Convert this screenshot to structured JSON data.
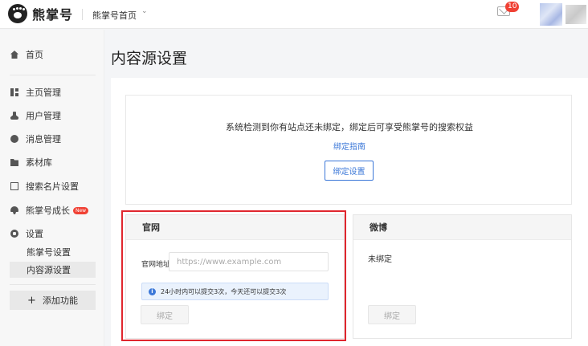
{
  "header": {
    "logo_text": "熊掌号",
    "nav_label": "熊掌号首页",
    "caret": "⌄",
    "notifications_count": "10"
  },
  "sidebar": {
    "items": [
      {
        "label": "首页",
        "icon": "home-icon"
      },
      {
        "label": "主页管理",
        "icon": "grid-icon"
      },
      {
        "label": "用户管理",
        "icon": "user-icon"
      },
      {
        "label": "消息管理",
        "icon": "message-icon"
      },
      {
        "label": "素材库",
        "icon": "folder-icon"
      },
      {
        "label": "搜索名片设置",
        "icon": "card-icon"
      },
      {
        "label": "熊掌号成长",
        "icon": "growth-icon",
        "tag": "New"
      },
      {
        "label": "设置",
        "icon": "gear-icon"
      }
    ],
    "sub_items": [
      {
        "label": "熊掌号设置"
      },
      {
        "label": "内容源设置",
        "active": true
      }
    ],
    "add_feature_label": "添加功能",
    "add_symbol": "+"
  },
  "main": {
    "title": "内容源设置",
    "bind_prompt": "系统检测到你有站点还未绑定，绑定后可享受熊掌号的搜索权益",
    "bind_guide_label": "绑定指南",
    "bind_settings_label": "绑定设置"
  },
  "site_card": {
    "title": "官网",
    "url_label": "官网地址",
    "url_value": "",
    "url_placeholder": "https://www.example.com",
    "notice_icon": "i",
    "notice": "24小时内可以提交3次，今天还可以提交3次",
    "bind_label": "绑定"
  },
  "weibo_card": {
    "title": "微博",
    "status": "未绑定",
    "bind_label": "绑定"
  },
  "colors": {
    "accent": "#3c78d8",
    "highlight": "#e0262e",
    "badge": "#f04134"
  }
}
